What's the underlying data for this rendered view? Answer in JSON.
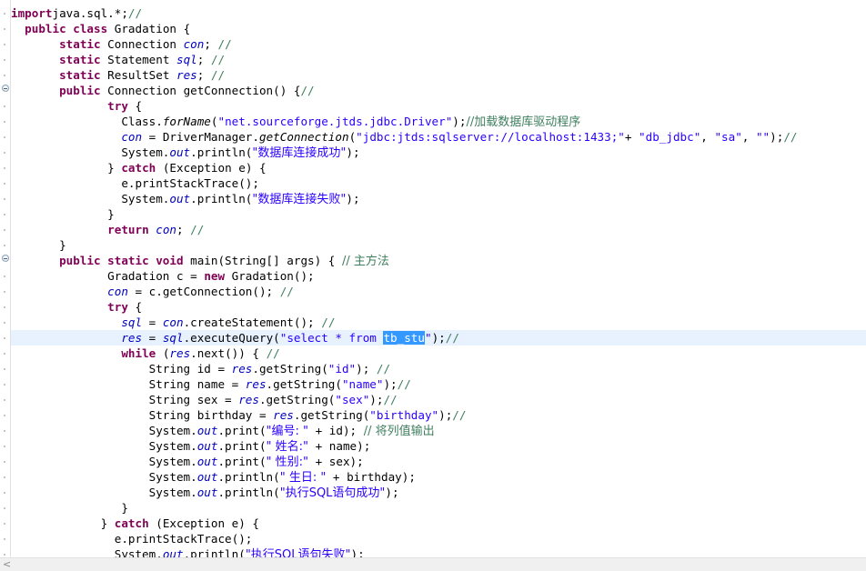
{
  "editor": {
    "scroll_left_arrow": "<",
    "lines": [
      [
        [
          "kw",
          "import"
        ],
        [
          "",
          "java.sql.*;"
        ],
        [
          "cmt",
          "//"
        ]
      ],
      [
        [
          "",
          "  "
        ],
        [
          "kw",
          "public class"
        ],
        [
          "",
          " Gradation {"
        ]
      ],
      [
        [
          "",
          "       "
        ],
        [
          "kw",
          "static"
        ],
        [
          "",
          " Connection "
        ],
        [
          "field",
          "con"
        ],
        [
          "",
          ";"
        ],
        [
          "cmt",
          " //"
        ]
      ],
      [
        [
          "",
          "       "
        ],
        [
          "kw",
          "static"
        ],
        [
          "",
          " Statement "
        ],
        [
          "field",
          "sql"
        ],
        [
          "",
          ";"
        ],
        [
          "cmt",
          " //"
        ]
      ],
      [
        [
          "",
          "       "
        ],
        [
          "kw",
          "static"
        ],
        [
          "",
          " ResultSet "
        ],
        [
          "field",
          "res"
        ],
        [
          "",
          ";"
        ],
        [
          "cmt",
          " //"
        ]
      ],
      [
        [
          "",
          "       "
        ],
        [
          "kw",
          "public"
        ],
        [
          "",
          " Connection getConnection() {"
        ],
        [
          "cmt",
          "//"
        ]
      ],
      [
        [
          "",
          "              "
        ],
        [
          "kw",
          "try"
        ],
        [
          "",
          " {"
        ]
      ],
      [
        [
          "",
          "                Class."
        ],
        [
          "mcall",
          "forName"
        ],
        [
          "",
          "("
        ],
        [
          "str",
          "\"net.sourceforge.jtds.jdbc.Driver\""
        ],
        [
          "",
          ");"
        ],
        [
          "cmt",
          "//加载数据库驱动程序"
        ]
      ],
      [
        [
          "",
          "                "
        ],
        [
          "field",
          "con"
        ],
        [
          "",
          " = DriverManager."
        ],
        [
          "mcall",
          "getConnection"
        ],
        [
          "",
          "("
        ],
        [
          "str",
          "\"jdbc:jtds:sqlserver://localhost:1433;\""
        ],
        [
          "",
          "+ "
        ],
        [
          "str",
          "\"db_jdbc\""
        ],
        [
          "",
          ", "
        ],
        [
          "str",
          "\"sa\""
        ],
        [
          "",
          ", "
        ],
        [
          "str",
          "\"\""
        ],
        [
          "",
          ");"
        ],
        [
          "cmt",
          "//"
        ]
      ],
      [
        [
          "",
          "                System."
        ],
        [
          "static",
          "out"
        ],
        [
          "",
          ".println("
        ],
        [
          "str",
          "\"数据库连接成功\""
        ],
        [
          "",
          ");"
        ]
      ],
      [
        [
          "",
          "              } "
        ],
        [
          "kw",
          "catch"
        ],
        [
          "",
          " (Exception e) {"
        ]
      ],
      [
        [
          "",
          "                e.printStackTrace();"
        ]
      ],
      [
        [
          "",
          "                System."
        ],
        [
          "static",
          "out"
        ],
        [
          "",
          ".println("
        ],
        [
          "str",
          "\"数据库连接失败\""
        ],
        [
          "",
          ");"
        ]
      ],
      [
        [
          "",
          "              }"
        ]
      ],
      [
        [
          "",
          "              "
        ],
        [
          "kw",
          "return"
        ],
        [
          "field",
          " con"
        ],
        [
          "",
          ";"
        ],
        [
          "cmt",
          " //"
        ]
      ],
      [
        [
          "",
          "       }"
        ]
      ],
      [
        [
          "",
          "       "
        ],
        [
          "kw",
          "public static void"
        ],
        [
          "",
          " main(String[] args) { "
        ],
        [
          "cmt",
          "// 主方法"
        ]
      ],
      [
        [
          "",
          "              Gradation c = "
        ],
        [
          "kw",
          "new"
        ],
        [
          "",
          " Gradation();"
        ]
      ],
      [
        [
          "",
          "              "
        ],
        [
          "field",
          "con"
        ],
        [
          "",
          " = c.getConnection(); "
        ],
        [
          "cmt",
          "//"
        ]
      ],
      [
        [
          "",
          "              "
        ],
        [
          "kw",
          "try"
        ],
        [
          "",
          " {"
        ]
      ],
      [
        [
          "",
          "                "
        ],
        [
          "field",
          "sql"
        ],
        [
          "",
          " = "
        ],
        [
          "field",
          "con"
        ],
        [
          "",
          ".createStatement(); "
        ],
        [
          "cmt",
          "//"
        ]
      ],
      [
        [
          "",
          "                "
        ],
        [
          "field",
          "res"
        ],
        [
          "",
          " = "
        ],
        [
          "field",
          "sql"
        ],
        [
          "",
          ".executeQuery("
        ],
        [
          "str",
          "\"select * from "
        ],
        [
          "sel",
          "tb_stu"
        ],
        [
          "str",
          "\""
        ],
        [
          "",
          ");"
        ],
        [
          "cmt",
          "//"
        ]
      ],
      [
        [
          "",
          "                "
        ],
        [
          "kw",
          "while"
        ],
        [
          "",
          " ("
        ],
        [
          "field",
          "res"
        ],
        [
          "",
          ".next()) { "
        ],
        [
          "cmt",
          "//"
        ]
      ],
      [
        [
          "",
          "                    String id = "
        ],
        [
          "field",
          "res"
        ],
        [
          "",
          ".getString("
        ],
        [
          "str",
          "\"id\""
        ],
        [
          "",
          "); "
        ],
        [
          "cmt",
          "//"
        ]
      ],
      [
        [
          "",
          "                    String name = "
        ],
        [
          "field",
          "res"
        ],
        [
          "",
          ".getString("
        ],
        [
          "str",
          "\"name\""
        ],
        [
          "",
          ");"
        ],
        [
          "cmt",
          "//"
        ]
      ],
      [
        [
          "",
          "                    String sex = "
        ],
        [
          "field",
          "res"
        ],
        [
          "",
          ".getString("
        ],
        [
          "str",
          "\"sex\""
        ],
        [
          "",
          ");"
        ],
        [
          "cmt",
          "//"
        ]
      ],
      [
        [
          "",
          "                    String birthday = "
        ],
        [
          "field",
          "res"
        ],
        [
          "",
          ".getString("
        ],
        [
          "str",
          "\"birthday\""
        ],
        [
          "",
          ");"
        ],
        [
          "cmt",
          "//"
        ]
      ],
      [
        [
          "",
          "                    System."
        ],
        [
          "static",
          "out"
        ],
        [
          "",
          ".print("
        ],
        [
          "str",
          "\"编号: \""
        ],
        [
          "",
          " + id); "
        ],
        [
          "cmt",
          "// 将列值输出"
        ]
      ],
      [
        [
          "",
          "                    System."
        ],
        [
          "static",
          "out"
        ],
        [
          "",
          ".print("
        ],
        [
          "str",
          "\" 姓名:\""
        ],
        [
          "",
          " + name);"
        ]
      ],
      [
        [
          "",
          "                    System."
        ],
        [
          "static",
          "out"
        ],
        [
          "",
          ".print("
        ],
        [
          "str",
          "\" 性别:\""
        ],
        [
          "",
          " + sex);"
        ]
      ],
      [
        [
          "",
          "                    System."
        ],
        [
          "static",
          "out"
        ],
        [
          "",
          ".println("
        ],
        [
          "str",
          "\" 生日: \""
        ],
        [
          "",
          " + birthday);"
        ]
      ],
      [
        [
          "",
          "                    System."
        ],
        [
          "static",
          "out"
        ],
        [
          "",
          ".println("
        ],
        [
          "str",
          "\"执行SQL语句成功\""
        ],
        [
          "",
          ");"
        ]
      ],
      [
        [
          "",
          "                }"
        ]
      ],
      [
        [
          "",
          "             } "
        ],
        [
          "kw",
          "catch"
        ],
        [
          "",
          " (Exception e) {"
        ]
      ],
      [
        [
          "",
          "               e.printStackTrace();"
        ]
      ],
      [
        [
          "",
          "               System."
        ],
        [
          "static",
          "out"
        ],
        [
          "",
          ".println("
        ],
        [
          "str",
          "\"执行SQL语句失败\""
        ],
        [
          "",
          ");"
        ]
      ]
    ]
  }
}
